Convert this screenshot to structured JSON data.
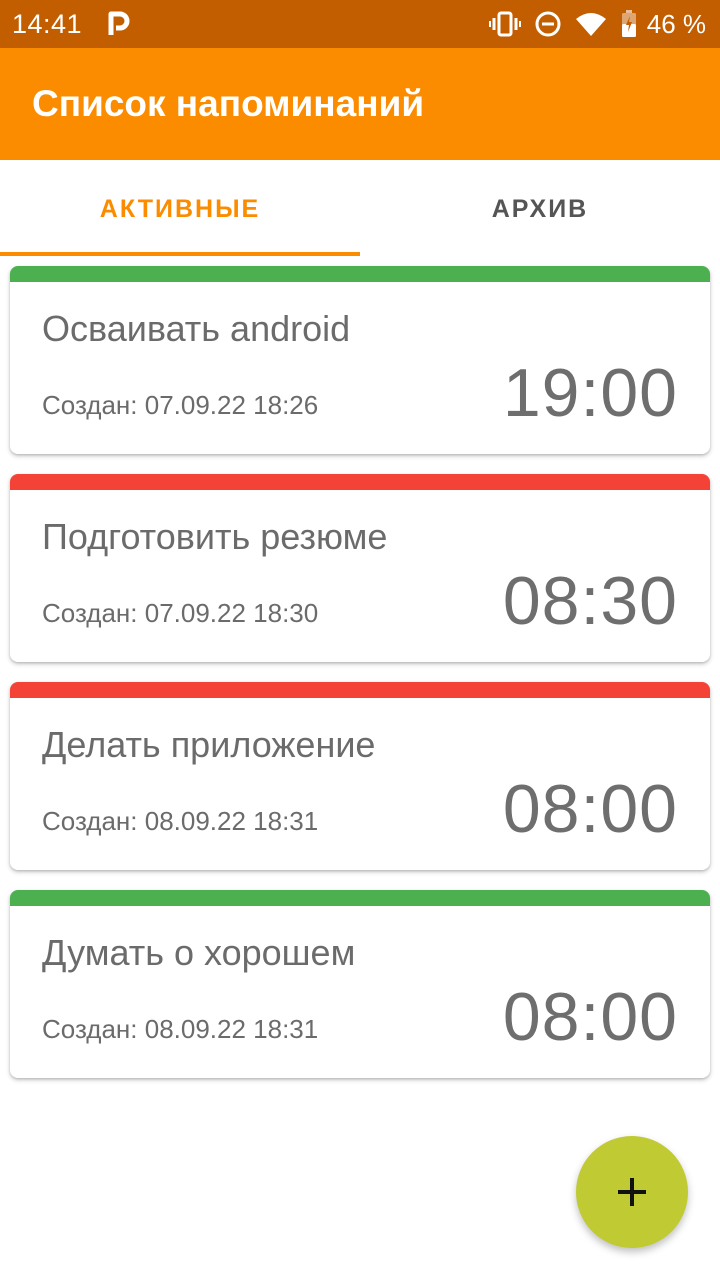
{
  "status_bar": {
    "time": "14:41",
    "app_icon": "p-notification-icon",
    "icons": [
      "vibrate-icon",
      "do-not-disturb-icon",
      "wifi-icon",
      "battery-icon"
    ],
    "battery_percent": "46 %"
  },
  "app_bar": {
    "title": "Список напоминаний",
    "color": "#fb8c00"
  },
  "tabs": [
    {
      "label": "АКТИВНЫЕ",
      "active": true
    },
    {
      "label": "АРХИВ",
      "active": false
    }
  ],
  "reminders": [
    {
      "title": "Осваивать android",
      "created": "Создан: 07.09.22 18:26",
      "time": "19:00",
      "stripe_color": "#4caf50"
    },
    {
      "title": "Подготовить резюме",
      "created": "Создан: 07.09.22 18:30",
      "time": "08:30",
      "stripe_color": "#f44336"
    },
    {
      "title": "Делать приложение",
      "created": "Создан: 08.09.22 18:31",
      "time": "08:00",
      "stripe_color": "#f44336"
    },
    {
      "title": "Думать о хорошем",
      "created": "Создан: 08.09.22 18:31",
      "time": "08:00",
      "stripe_color": "#4caf50"
    }
  ],
  "fab": {
    "icon": "plus-icon",
    "color": "#c0ca33"
  }
}
